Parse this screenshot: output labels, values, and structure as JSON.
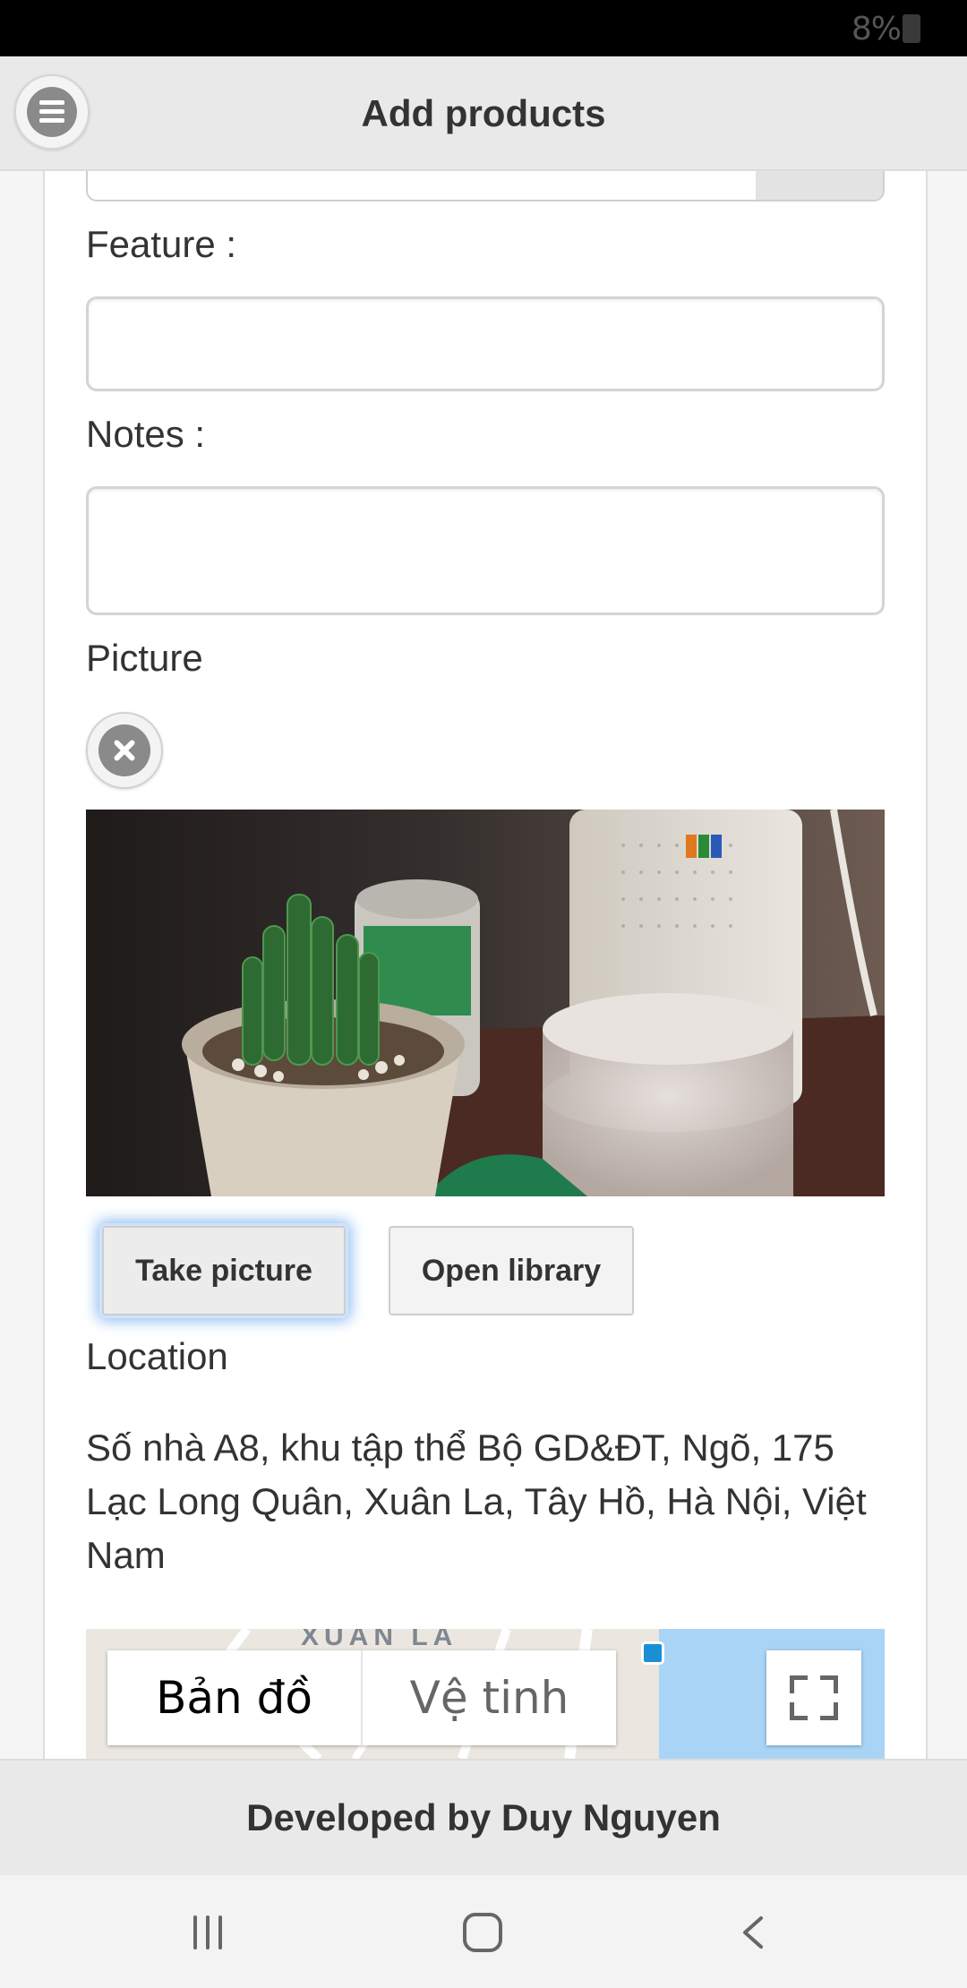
{
  "status_bar": {
    "battery_text": "8%"
  },
  "header": {
    "title": "Add products"
  },
  "form": {
    "feature_label": "Feature :",
    "feature_value": "",
    "notes_label": "Notes :",
    "notes_value": "",
    "picture_label": "Picture",
    "take_picture_label": "Take picture",
    "open_library_label": "Open library",
    "location_label": "Location",
    "address": "Số nhà A8, khu tập thể Bộ GD&ĐT, Ngõ, 175 Lạc Long Quân, Xuân La, Tây Hồ, Hà Nội, Việt Nam"
  },
  "map": {
    "area_label": "XUAN LA",
    "map_type_options": [
      "Bản đồ",
      "Vệ tinh"
    ],
    "selected_map_type": "Bản đồ"
  },
  "footer": {
    "text": "Developed by Duy Nguyen"
  },
  "colors": {
    "header_bg": "#e9e9e9",
    "focus_glow": "#8fbdf1",
    "water": "#a9d4f6"
  }
}
